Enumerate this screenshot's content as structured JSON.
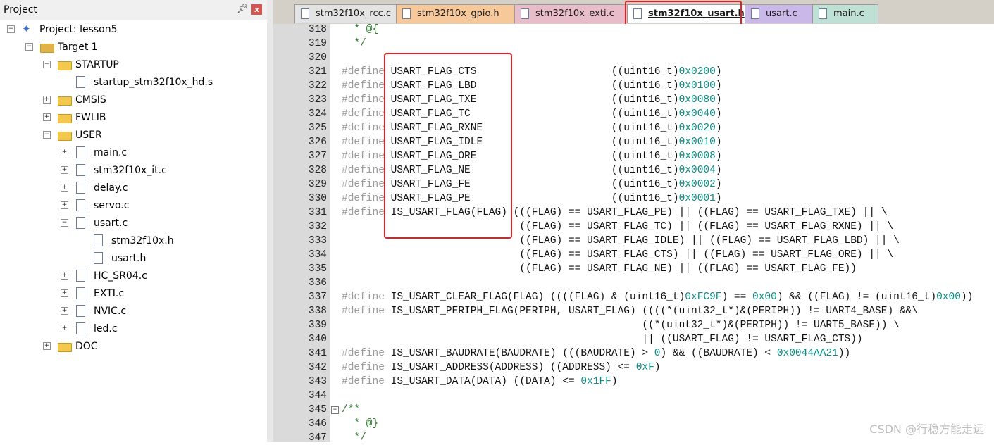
{
  "project_pane": {
    "title": "Project",
    "pin_icon": "pin-icon",
    "close_label": "x",
    "tree": [
      {
        "label": "Project: lesson5",
        "kind": "project",
        "expander": "−",
        "level": 0
      },
      {
        "label": "Target 1",
        "kind": "target",
        "expander": "−",
        "level": 1
      },
      {
        "label": "STARTUP",
        "kind": "folder",
        "expander": "−",
        "level": 2
      },
      {
        "label": "startup_stm32f10x_hd.s",
        "kind": "file",
        "expander": "",
        "level": 3
      },
      {
        "label": "CMSIS",
        "kind": "folder",
        "expander": "+",
        "level": 2
      },
      {
        "label": "FWLIB",
        "kind": "folder",
        "expander": "+",
        "level": 2
      },
      {
        "label": "USER",
        "kind": "folder",
        "expander": "−",
        "level": 2
      },
      {
        "label": "main.c",
        "kind": "file",
        "expander": "+",
        "level": 3
      },
      {
        "label": "stm32f10x_it.c",
        "kind": "file",
        "expander": "+",
        "level": 3
      },
      {
        "label": "delay.c",
        "kind": "file",
        "expander": "+",
        "level": 3
      },
      {
        "label": "servo.c",
        "kind": "file",
        "expander": "+",
        "level": 3
      },
      {
        "label": "usart.c",
        "kind": "file",
        "expander": "−",
        "level": 3
      },
      {
        "label": "stm32f10x.h",
        "kind": "file",
        "expander": "",
        "level": 4
      },
      {
        "label": "usart.h",
        "kind": "file",
        "expander": "",
        "level": 4
      },
      {
        "label": "HC_SR04.c",
        "kind": "file",
        "expander": "+",
        "level": 3
      },
      {
        "label": "EXTI.c",
        "kind": "file",
        "expander": "+",
        "level": 3
      },
      {
        "label": "NVIC.c",
        "kind": "file",
        "expander": "+",
        "level": 3
      },
      {
        "label": "led.c",
        "kind": "file",
        "expander": "+",
        "level": 3
      },
      {
        "label": "DOC",
        "kind": "folder",
        "expander": "+",
        "level": 2
      }
    ]
  },
  "tabs": [
    {
      "label": "stm32f10x_rcc.c",
      "color": "#e3e3e3",
      "active": false
    },
    {
      "label": "stm32f10x_gpio.h",
      "color": "#f6c89a",
      "active": false
    },
    {
      "label": "stm32f10x_exti.c",
      "color": "#e8bcc9",
      "active": false
    },
    {
      "label": "stm32f10x_usart.h",
      "color": "#ffffff",
      "active": true
    },
    {
      "label": "usart.c",
      "color": "#c9b8e8",
      "active": false
    },
    {
      "label": "main.c",
      "color": "#bfe0d4",
      "active": false
    }
  ],
  "code_lines": [
    {
      "n": "318",
      "fold": "",
      "parts": [
        [
          "c",
          "  * @{"
        ]
      ]
    },
    {
      "n": "319",
      "fold": "",
      "parts": [
        [
          "c",
          "  */"
        ]
      ]
    },
    {
      "n": "320",
      "fold": "",
      "parts": []
    },
    {
      "n": "321",
      "fold": "",
      "parts": [
        [
          "k",
          "#define"
        ],
        [
          "t",
          " USART_FLAG_CTS                      ((uint16_t)"
        ],
        [
          "n",
          "0x0200"
        ],
        [
          "t",
          ")"
        ]
      ]
    },
    {
      "n": "322",
      "fold": "",
      "parts": [
        [
          "k",
          "#define"
        ],
        [
          "t",
          " USART_FLAG_LBD                      ((uint16_t)"
        ],
        [
          "n",
          "0x0100"
        ],
        [
          "t",
          ")"
        ]
      ]
    },
    {
      "n": "323",
      "fold": "",
      "parts": [
        [
          "k",
          "#define"
        ],
        [
          "t",
          " USART_FLAG_TXE                      ((uint16_t)"
        ],
        [
          "n",
          "0x0080"
        ],
        [
          "t",
          ")"
        ]
      ]
    },
    {
      "n": "324",
      "fold": "",
      "parts": [
        [
          "k",
          "#define"
        ],
        [
          "t",
          " USART_FLAG_TC                       ((uint16_t)"
        ],
        [
          "n",
          "0x0040"
        ],
        [
          "t",
          ")"
        ]
      ]
    },
    {
      "n": "325",
      "fold": "",
      "parts": [
        [
          "k",
          "#define"
        ],
        [
          "t",
          " USART_FLAG_RXNE                     ((uint16_t)"
        ],
        [
          "n",
          "0x0020"
        ],
        [
          "t",
          ")"
        ]
      ]
    },
    {
      "n": "326",
      "fold": "",
      "parts": [
        [
          "k",
          "#define"
        ],
        [
          "t",
          " USART_FLAG_IDLE                     ((uint16_t)"
        ],
        [
          "n",
          "0x0010"
        ],
        [
          "t",
          ")"
        ]
      ]
    },
    {
      "n": "327",
      "fold": "",
      "parts": [
        [
          "k",
          "#define"
        ],
        [
          "t",
          " USART_FLAG_ORE                      ((uint16_t)"
        ],
        [
          "n",
          "0x0008"
        ],
        [
          "t",
          ")"
        ]
      ]
    },
    {
      "n": "328",
      "fold": "",
      "parts": [
        [
          "k",
          "#define"
        ],
        [
          "t",
          " USART_FLAG_NE                       ((uint16_t)"
        ],
        [
          "n",
          "0x0004"
        ],
        [
          "t",
          ")"
        ]
      ]
    },
    {
      "n": "329",
      "fold": "",
      "parts": [
        [
          "k",
          "#define"
        ],
        [
          "t",
          " USART_FLAG_FE                       ((uint16_t)"
        ],
        [
          "n",
          "0x0002"
        ],
        [
          "t",
          ")"
        ]
      ]
    },
    {
      "n": "330",
      "fold": "",
      "parts": [
        [
          "k",
          "#define"
        ],
        [
          "t",
          " USART_FLAG_PE                       ((uint16_t)"
        ],
        [
          "n",
          "0x0001"
        ],
        [
          "t",
          ")"
        ]
      ]
    },
    {
      "n": "331",
      "fold": "",
      "parts": [
        [
          "k",
          "#define"
        ],
        [
          "t",
          " IS_USART_FLAG(FLAG) (((FLAG) == USART_FLAG_PE) || ((FLAG) == USART_FLAG_TXE) || \\"
        ]
      ]
    },
    {
      "n": "332",
      "fold": "",
      "parts": [
        [
          "t",
          "                             ((FLAG) == USART_FLAG_TC) || ((FLAG) == USART_FLAG_RXNE) || \\"
        ]
      ]
    },
    {
      "n": "333",
      "fold": "",
      "parts": [
        [
          "t",
          "                             ((FLAG) == USART_FLAG_IDLE) || ((FLAG) == USART_FLAG_LBD) || \\"
        ]
      ]
    },
    {
      "n": "334",
      "fold": "",
      "parts": [
        [
          "t",
          "                             ((FLAG) == USART_FLAG_CTS) || ((FLAG) == USART_FLAG_ORE) || \\"
        ]
      ]
    },
    {
      "n": "335",
      "fold": "",
      "parts": [
        [
          "t",
          "                             ((FLAG) == USART_FLAG_NE) || ((FLAG) == USART_FLAG_FE))"
        ]
      ]
    },
    {
      "n": "336",
      "fold": "",
      "parts": []
    },
    {
      "n": "337",
      "fold": "",
      "parts": [
        [
          "k",
          "#define"
        ],
        [
          "t",
          " IS_USART_CLEAR_FLAG(FLAG) ((((FLAG) & (uint16_t)"
        ],
        [
          "n",
          "0xFC9F"
        ],
        [
          "t",
          ") == "
        ],
        [
          "n",
          "0x00"
        ],
        [
          "t",
          ") && ((FLAG) != (uint16_t)"
        ],
        [
          "n",
          "0x00"
        ],
        [
          "t",
          "))"
        ]
      ]
    },
    {
      "n": "338",
      "fold": "",
      "parts": [
        [
          "k",
          "#define"
        ],
        [
          "t",
          " IS_USART_PERIPH_FLAG(PERIPH, USART_FLAG) ((((*(uint32_t*)&(PERIPH)) != UART4_BASE) &&\\"
        ]
      ]
    },
    {
      "n": "339",
      "fold": "",
      "parts": [
        [
          "t",
          "                                                 ((*(uint32_t*)&(PERIPH)) != UART5_BASE)) \\"
        ]
      ]
    },
    {
      "n": "340",
      "fold": "",
      "parts": [
        [
          "t",
          "                                                 || ((USART_FLAG) != USART_FLAG_CTS))"
        ]
      ]
    },
    {
      "n": "341",
      "fold": "",
      "parts": [
        [
          "k",
          "#define"
        ],
        [
          "t",
          " IS_USART_BAUDRATE(BAUDRATE) (((BAUDRATE) > "
        ],
        [
          "n",
          "0"
        ],
        [
          "t",
          ") && ((BAUDRATE) < "
        ],
        [
          "n",
          "0x0044AA21"
        ],
        [
          "t",
          "))"
        ]
      ]
    },
    {
      "n": "342",
      "fold": "",
      "parts": [
        [
          "k",
          "#define"
        ],
        [
          "t",
          " IS_USART_ADDRESS(ADDRESS) ((ADDRESS) <= "
        ],
        [
          "n",
          "0xF"
        ],
        [
          "t",
          ")"
        ]
      ]
    },
    {
      "n": "343",
      "fold": "",
      "parts": [
        [
          "k",
          "#define"
        ],
        [
          "t",
          " IS_USART_DATA(DATA) ((DATA) <= "
        ],
        [
          "n",
          "0x1FF"
        ],
        [
          "t",
          ")"
        ]
      ]
    },
    {
      "n": "344",
      "fold": "",
      "parts": []
    },
    {
      "n": "345",
      "fold": "−",
      "parts": [
        [
          "c",
          "/**"
        ]
      ]
    },
    {
      "n": "346",
      "fold": "",
      "parts": [
        [
          "c",
          "  * @}"
        ]
      ]
    },
    {
      "n": "347",
      "fold": "",
      "parts": [
        [
          "c",
          "  */"
        ]
      ]
    }
  ],
  "watermark": "CSDN @行稳方能走远"
}
